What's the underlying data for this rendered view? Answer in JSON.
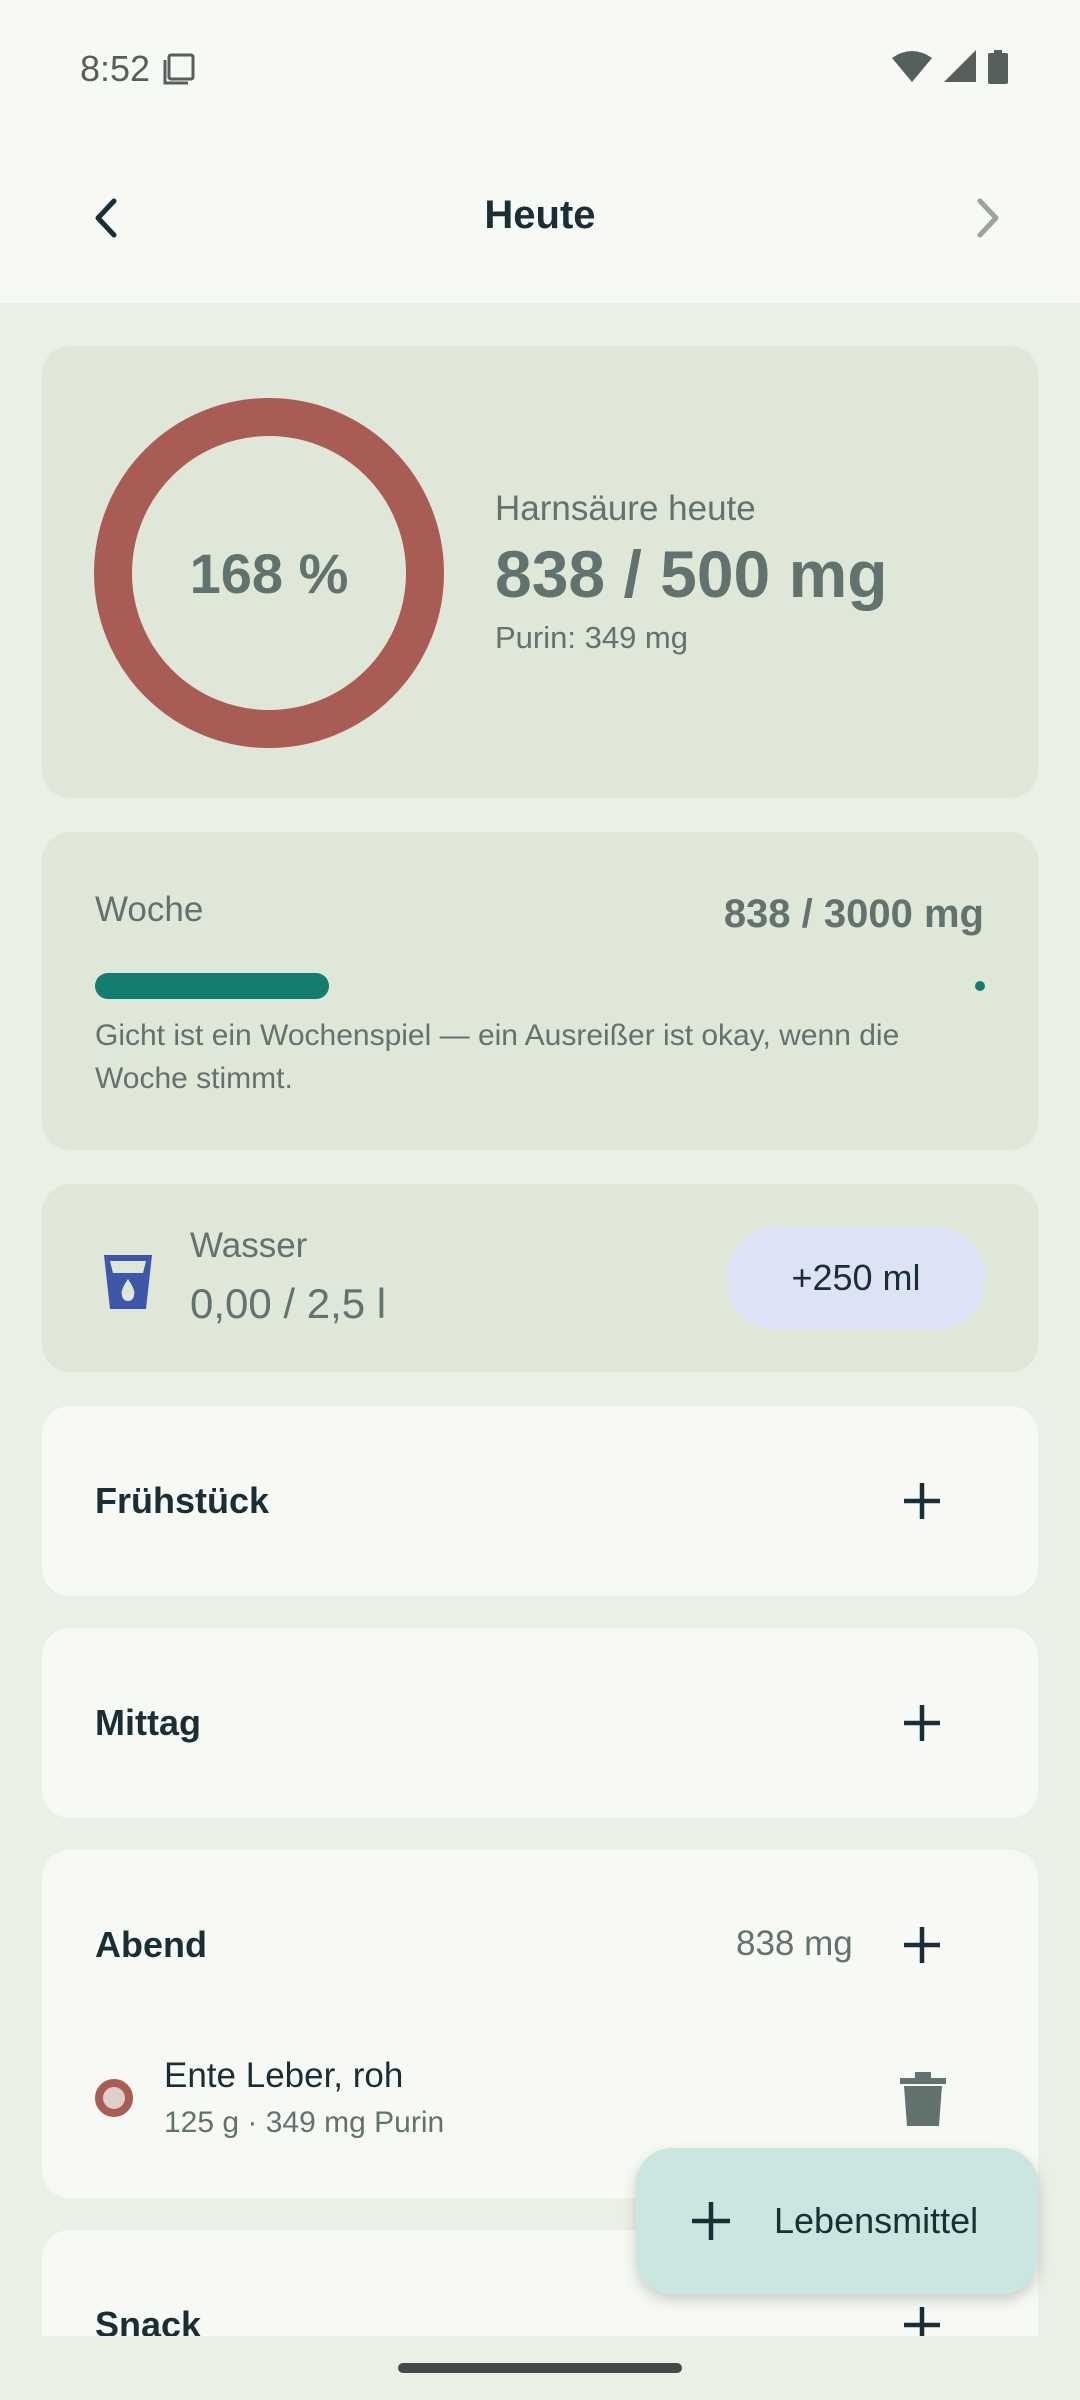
{
  "status": {
    "time": "8:52"
  },
  "appbar": {
    "title": "Heute"
  },
  "uric": {
    "percent_label": "168 %",
    "percent": 168,
    "label": "Harnsäure heute",
    "value": "838 / 500 mg",
    "purin": "Purin: 349 mg",
    "ring_color": "#a85c54"
  },
  "week": {
    "label": "Woche",
    "value": "838 / 3000 mg",
    "progress": 0.28,
    "note": "Gicht ist ein Wochenspiel — ein Ausreißer ist okay, wenn die Woche stimmt."
  },
  "water": {
    "label": "Wasser",
    "value": "0,00 / 2,5 l",
    "add_button": "+250 ml"
  },
  "meals": [
    {
      "title": "Frühstück"
    },
    {
      "title": "Mittag"
    },
    {
      "title": "Abend",
      "total": "838 mg",
      "items": [
        {
          "name": "Ente Leber, roh",
          "detail": "125 g · 349 mg Purin"
        }
      ]
    },
    {
      "title": "Snack"
    }
  ],
  "fab": {
    "label": "Lebensmittel"
  },
  "colors": {
    "accent": "#137d6f",
    "warning": "#a85c54",
    "card": "#dfe7d9"
  }
}
